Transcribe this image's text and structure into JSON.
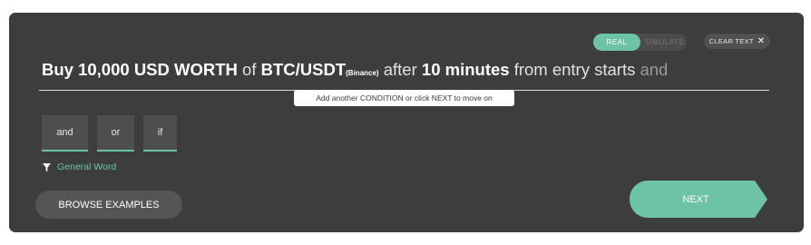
{
  "mode_toggle": {
    "real_label": "REAL",
    "simulate_label": "SIMULATE",
    "selected": "REAL"
  },
  "clear_text": {
    "label": "CLEAR TEXT",
    "icon": "close-icon"
  },
  "sentence": {
    "part1": "Buy 10,000 USD WORTH",
    "part2": "of",
    "part3": "BTC/USDT",
    "exchange": "(Binance)",
    "part4": "after",
    "part5": "10 minutes",
    "part6": "from entry starts",
    "suggestion": "and"
  },
  "hint": "Add another CONDITION or click NEXT to move on",
  "word_options": [
    "and",
    "or",
    "if"
  ],
  "filter": {
    "icon": "filter-icon",
    "label": "General Word"
  },
  "browse_button": "BROWSE EXAMPLES",
  "next_button": "NEXT",
  "colors": {
    "panel": "#3d3d3d",
    "accent": "#6dc3a8",
    "button_dark": "#555555"
  }
}
